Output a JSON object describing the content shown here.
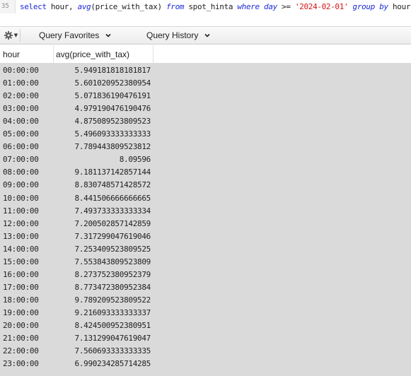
{
  "editor": {
    "line_number": "35",
    "query": {
      "select": "select",
      "cols": " hour, ",
      "fn": "avg",
      "args": "(price_with_tax) ",
      "from": "from",
      "table": " spot_hinta ",
      "where": "where",
      "day": " day ",
      "op": ">= ",
      "date": "'2024-02-01'",
      "sp": " ",
      "group": "group",
      "sp2": " ",
      "by": "by",
      "tail": " hour;"
    }
  },
  "toolbar": {
    "settings_icon": "gear-icon",
    "query_favorites": "Query Favorites",
    "query_history": "Query History"
  },
  "grid": {
    "columns": [
      "hour",
      "avg(price_with_tax)"
    ],
    "rows": [
      [
        "00:00:00",
        "5.949181818181817"
      ],
      [
        "01:00:00",
        "5.601020952380954"
      ],
      [
        "02:00:00",
        "5.071836190476191"
      ],
      [
        "03:00:00",
        "4.979190476190476"
      ],
      [
        "04:00:00",
        "4.875089523809523"
      ],
      [
        "05:00:00",
        "5.496093333333333"
      ],
      [
        "06:00:00",
        "7.789443809523812"
      ],
      [
        "07:00:00",
        "8.09596"
      ],
      [
        "08:00:00",
        "9.181137142857144"
      ],
      [
        "09:00:00",
        "8.830748571428572"
      ],
      [
        "10:00:00",
        "8.441506666666665"
      ],
      [
        "11:00:00",
        "7.493733333333334"
      ],
      [
        "12:00:00",
        "7.200502857142859"
      ],
      [
        "13:00:00",
        "7.317299047619046"
      ],
      [
        "14:00:00",
        "7.253409523809525"
      ],
      [
        "15:00:00",
        "7.553843809523809"
      ],
      [
        "16:00:00",
        "8.273752380952379"
      ],
      [
        "17:00:00",
        "8.773472380952384"
      ],
      [
        "18:00:00",
        "9.789209523809522"
      ],
      [
        "19:00:00",
        "9.216093333333337"
      ],
      [
        "20:00:00",
        "8.424500952380951"
      ],
      [
        "21:00:00",
        "7.131299047619047"
      ],
      [
        "22:00:00",
        "7.560693333333335"
      ],
      [
        "23:00:00",
        "6.990234285714285"
      ]
    ]
  }
}
